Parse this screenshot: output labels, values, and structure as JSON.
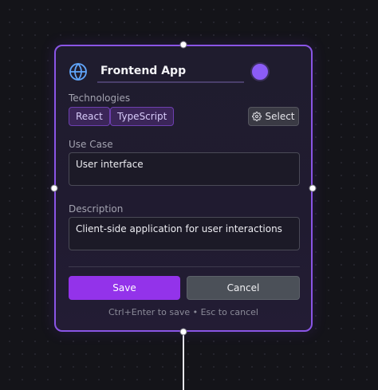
{
  "node": {
    "title": "Frontend App",
    "icon": "globe-icon",
    "color": "#8b5cf6",
    "technologies_label": "Technologies",
    "technologies": [
      "React",
      "TypeScript"
    ],
    "select_label": "Select",
    "select_icon": "gear-icon",
    "use_case_label": "Use Case",
    "use_case_value": "User interface",
    "description_label": "Description",
    "description_value": "Client-side application for user interactions",
    "save_label": "Save",
    "cancel_label": "Cancel",
    "hint": "Ctrl+Enter to save • Esc to cancel"
  },
  "colors": {
    "accent": "#8b5cf6",
    "save_button": "#9333ea",
    "cancel_button": "#4b5058",
    "border": "#8a55e6"
  }
}
